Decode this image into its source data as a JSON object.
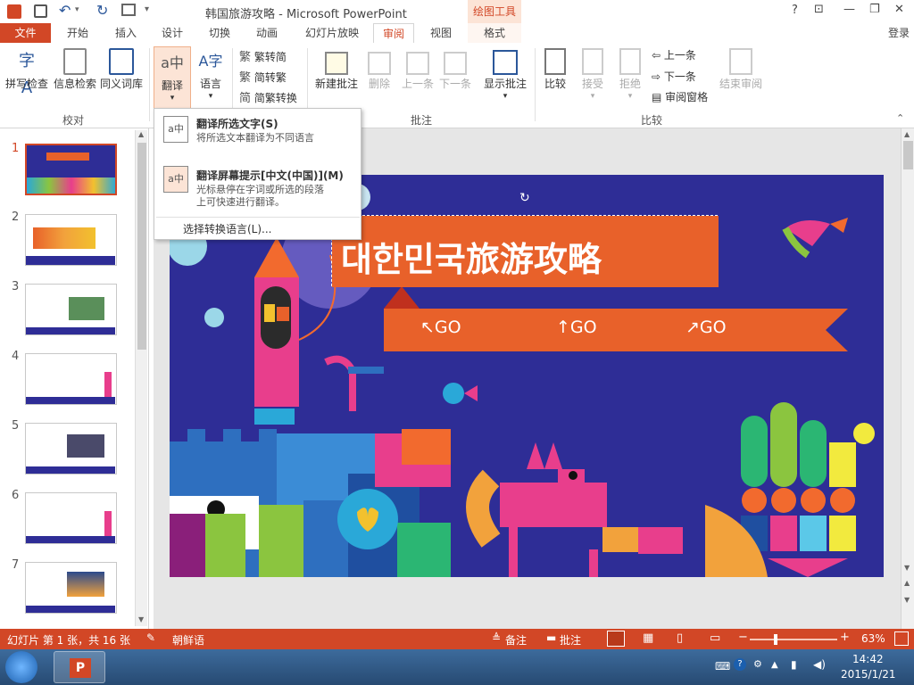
{
  "window": {
    "title": "韩国旅游攻略 - Microsoft PowerPoint",
    "context_tab": "绘图工具",
    "controls": {
      "help": "?",
      "ribbon_display": "⊡",
      "minimize": "—",
      "restore": "❐",
      "close": "✕"
    }
  },
  "quick_access": {
    "save": "save-icon",
    "undo": "undo-icon",
    "redo": "redo-icon",
    "start_from_beginning": "slideshow-icon",
    "customize": "▾"
  },
  "tabs": [
    "文件",
    "开始",
    "插入",
    "设计",
    "切换",
    "动画",
    "幻灯片放映",
    "审阅",
    "视图",
    "格式"
  ],
  "active_tab": "审阅",
  "signin": "登录",
  "ribbon": {
    "proofing": {
      "spell": "拼写检查",
      "research": "信息检索",
      "thesaurus": "同义词库",
      "group": "校对"
    },
    "language": {
      "translate": "翻译",
      "language": "语言"
    },
    "chinese": {
      "to_simplified": "繁转简",
      "to_traditional": "简转繁",
      "conversion": "简繁转换"
    },
    "comments": {
      "new": "新建批注",
      "delete": "删除",
      "previous": "上一条",
      "next": "下一条",
      "show": "显示批注",
      "group": "批注"
    },
    "compare": {
      "compare": "比较",
      "accept": "接受",
      "reject": "拒绝",
      "prev": "上一条",
      "next": "下一条",
      "pane": "审阅窗格",
      "end": "结束审阅",
      "group": "比较"
    }
  },
  "translate_menu": {
    "item1_title": "翻译所选文字(S)",
    "item1_desc": "将所选文本翻译为不同语言",
    "item2_title": "翻译屏幕提示[中文(中国)](M)",
    "item2_desc1": "光标悬停在字词或所选的段落",
    "item2_desc2": "上可快速进行翻译。",
    "item3": "选择转换语言(L)..."
  },
  "thumbnails": [
    "1",
    "2",
    "3",
    "4",
    "5",
    "6",
    "7"
  ],
  "slide": {
    "title": "대한민국旅游攻略",
    "go_left": "↖GO",
    "go_up": "↑GO",
    "go_right": "↗GO"
  },
  "status": {
    "slide_info": "幻灯片 第 1 张，共 16 张",
    "language": "朝鲜语",
    "notes": "备注",
    "comments": "批注",
    "zoom": "63%",
    "zoom_fraction": 0.63
  },
  "taskbar": {
    "time": "14:42",
    "date": "2015/1/21"
  },
  "colors": {
    "accent": "#d24726",
    "slide_bg": "#2e2d96",
    "banner": "#e8612a"
  }
}
